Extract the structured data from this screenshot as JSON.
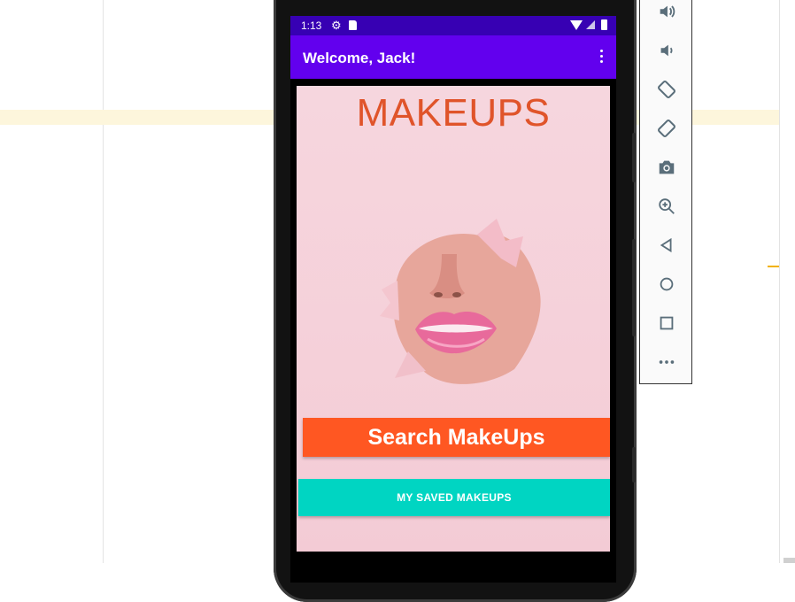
{
  "status_bar": {
    "time": "1:13"
  },
  "app_bar": {
    "title": "Welcome, Jack!"
  },
  "content": {
    "headline": "MAKEUPS"
  },
  "buttons": {
    "search": "Search MakeUps",
    "saved": "MY SAVED MAKEUPS"
  },
  "colors": {
    "status_bar": "#3700b3",
    "app_bar": "#6200ee",
    "headline": "#e0542a",
    "search_button": "#ff5722",
    "saved_button": "#00d5c2",
    "content_bg": "#f6d4dd"
  },
  "emulator_toolbar": {
    "icons": [
      "volume-up-icon",
      "volume-down-icon",
      "rotate-left-icon",
      "rotate-right-icon",
      "camera-icon",
      "zoom-in-icon",
      "back-icon",
      "home-icon",
      "overview-icon",
      "more-icon"
    ]
  }
}
